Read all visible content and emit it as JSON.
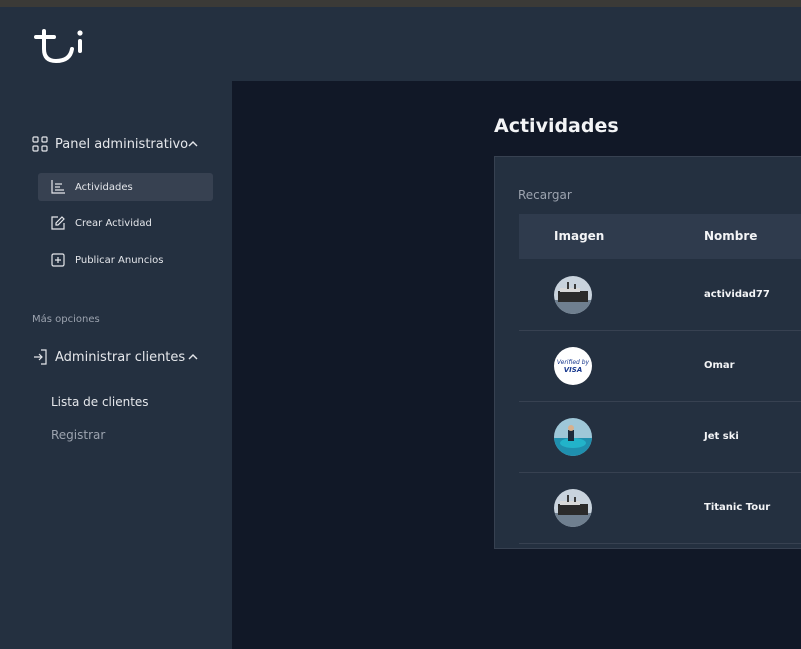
{
  "sidebar": {
    "panel": {
      "label": "Panel administrativo",
      "icon": "grid-icon"
    },
    "panel_items": [
      {
        "label": "Actividades",
        "icon": "chart-icon",
        "active": true
      },
      {
        "label": "Crear Actividad",
        "icon": "edit-icon",
        "active": false
      },
      {
        "label": "Publicar Anuncios",
        "icon": "plus-square-icon",
        "active": false
      }
    ],
    "more_label": "Más opciones",
    "clients": {
      "label": "Administrar clientes",
      "icon": "login-icon"
    },
    "client_items": [
      {
        "label": "Lista de clientes"
      },
      {
        "label": "Registrar"
      }
    ]
  },
  "main": {
    "title": "Actividades",
    "reload": "Recargar",
    "columns": [
      "Imagen",
      "Nombre"
    ],
    "rows": [
      {
        "name": "actividad77",
        "image": "ship-thumbnail"
      },
      {
        "name": "Omar",
        "image": "verified-by-visa-thumbnail"
      },
      {
        "name": "Jet ski",
        "image": "jet-ski-thumbnail"
      },
      {
        "name": "Titanic Tour",
        "image": "ship-thumbnail"
      }
    ],
    "visa_text": [
      "Verified by",
      "VISA"
    ]
  },
  "colors": {
    "sidebar": "#243040",
    "main": "#111827",
    "active": "#374151",
    "text": "#e5e7eb",
    "muted": "#9ca3af"
  }
}
